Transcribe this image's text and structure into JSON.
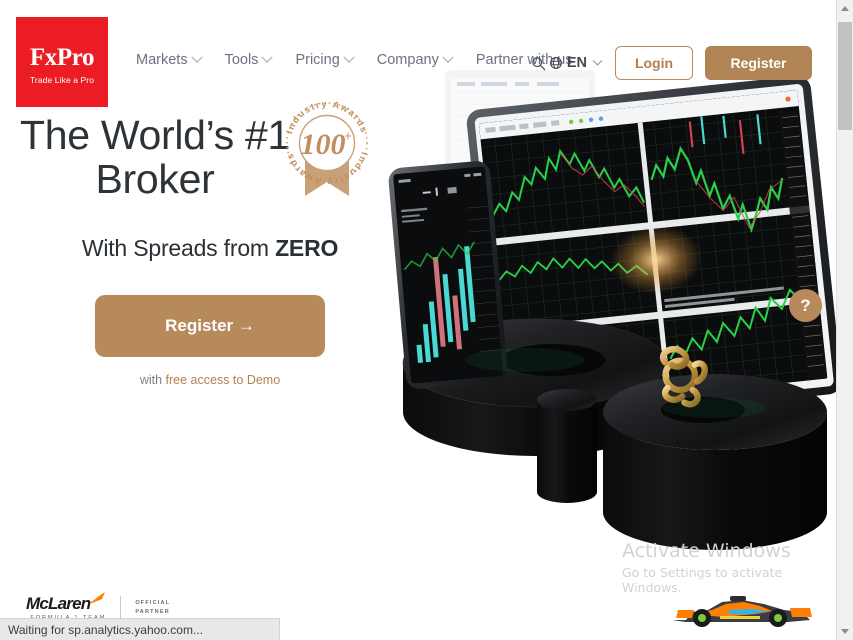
{
  "brand": {
    "logo_text": "FxPro",
    "logo_tagline": "Trade Like a Pro",
    "logo_bg": "#ec1c24",
    "accent": "#b08455"
  },
  "header": {
    "nav": [
      {
        "label": "Markets",
        "has_dropdown": true
      },
      {
        "label": "Tools",
        "has_dropdown": true
      },
      {
        "label": "Pricing",
        "has_dropdown": true
      },
      {
        "label": "Company",
        "has_dropdown": true
      },
      {
        "label": "Partner with us",
        "has_dropdown": false
      }
    ],
    "search_icon": "search-icon",
    "globe_icon": "globe-icon",
    "language": "EN",
    "login_label": "Login",
    "register_label": "Register"
  },
  "hero": {
    "headline": "The World’s #1 Broker",
    "subheadline_prefix": "With Spreads from ",
    "subheadline_strong": "ZERO",
    "cta_label": "Register →",
    "cta_note_prefix": "with ",
    "cta_note_accent": "free access to Demo",
    "badge": {
      "value": "100",
      "plus": "+",
      "ring_text_top": "Industry Awards",
      "ring_text_bottom": "Industry Awards",
      "color": "#c9a178"
    },
    "help_button": "?"
  },
  "footer": {
    "partner_word": "McLaren",
    "partner_sub": "FORMULA 1 TEAM",
    "partner_role_line1": "OFFICIAL",
    "partner_role_line2": "PARTNER"
  },
  "watermark": {
    "title": "Activate Windows",
    "subtitle": "Go to Settings to activate Windows."
  },
  "statusbar": {
    "text": "Waiting for sp.analytics.yahoo.com..."
  }
}
